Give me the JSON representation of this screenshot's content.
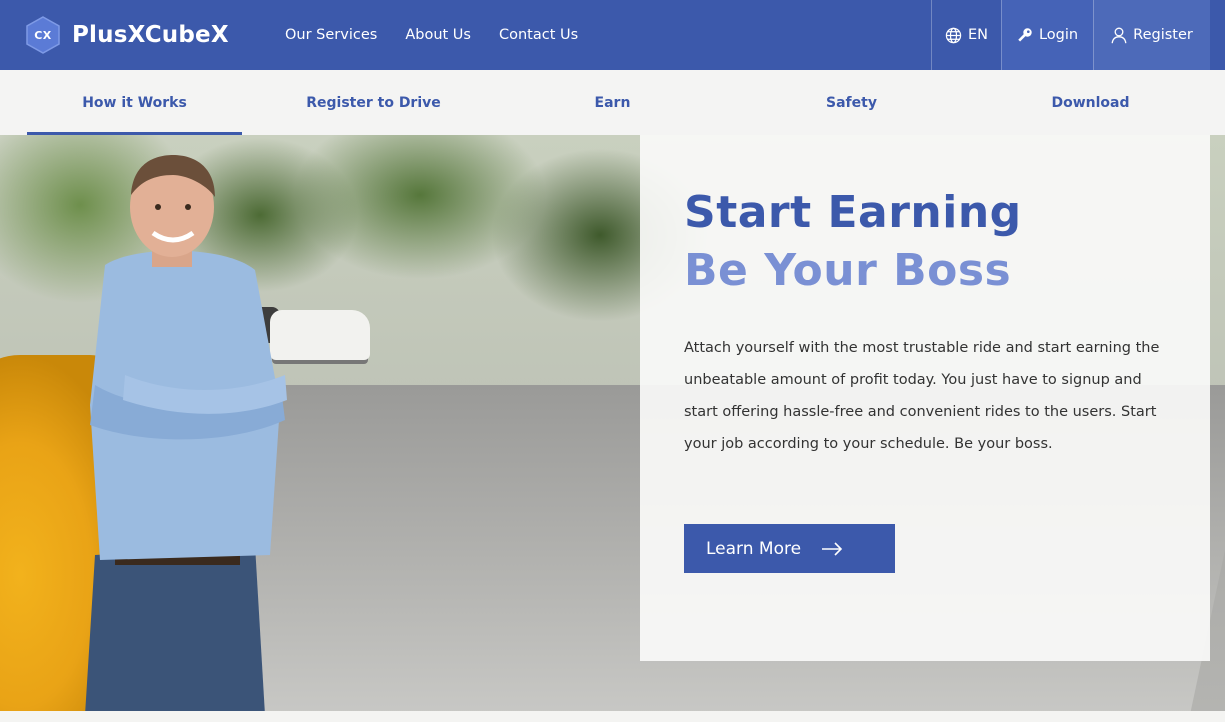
{
  "brand": {
    "logo_text": "CX",
    "name": "PlusXCubeX"
  },
  "header": {
    "nav": [
      {
        "label": "Our Services"
      },
      {
        "label": "About Us"
      },
      {
        "label": "Contact Us"
      }
    ],
    "language": "EN",
    "login": "Login",
    "register": "Register"
  },
  "subnav": {
    "tabs": [
      {
        "label": "How it Works",
        "active": true
      },
      {
        "label": "Register to Drive"
      },
      {
        "label": "Earn"
      },
      {
        "label": "Safety"
      },
      {
        "label": "Download"
      }
    ]
  },
  "hero": {
    "headline_line1": "Start Earning",
    "headline_line2": "Be Your Boss",
    "description": "Attach yourself with the most trustable ride and start earning the unbeatable amount of profit today. You just have to signup and start offering hassle-free and convenient rides to the users. Start your job according to your schedule. Be your boss.",
    "cta": "Learn More"
  },
  "colors": {
    "primary": "#3c59ab",
    "headline_secondary": "#7a90d4",
    "text": "#333333"
  },
  "icons": [
    "globe-icon",
    "key-icon",
    "user-icon",
    "arrow-right-icon"
  ]
}
